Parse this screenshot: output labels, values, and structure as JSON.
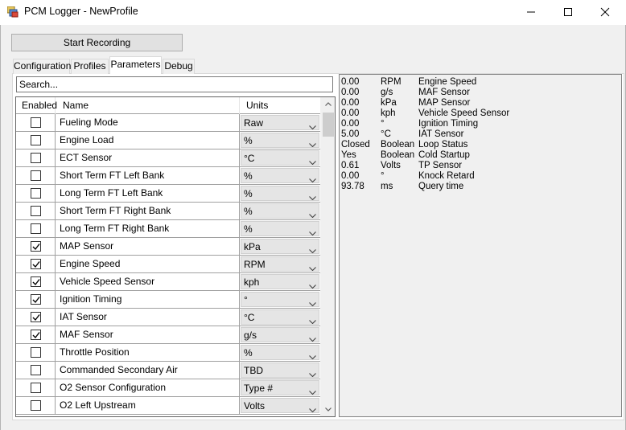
{
  "window": {
    "title": "PCM Logger - NewProfile"
  },
  "toolbar": {
    "start_label": "Start Recording"
  },
  "tabs": [
    {
      "label": "Configuration"
    },
    {
      "label": "Profiles"
    },
    {
      "label": "Parameters",
      "active": true
    },
    {
      "label": "Debug"
    }
  ],
  "search": {
    "placeholder": "Search..."
  },
  "grid": {
    "headers": {
      "enabled": "Enabled",
      "name": "Name",
      "units": "Units"
    },
    "rows": [
      {
        "enabled": false,
        "name": "Fueling Mode",
        "units": "Raw"
      },
      {
        "enabled": false,
        "name": "Engine Load",
        "units": "%"
      },
      {
        "enabled": false,
        "name": "ECT Sensor",
        "units": "°C"
      },
      {
        "enabled": false,
        "name": "Short Term FT Left Bank",
        "units": "%"
      },
      {
        "enabled": false,
        "name": "Long Term FT Left Bank",
        "units": "%"
      },
      {
        "enabled": false,
        "name": "Short Term FT Right Bank",
        "units": "%"
      },
      {
        "enabled": false,
        "name": "Long Term FT Right Bank",
        "units": "%"
      },
      {
        "enabled": true,
        "name": "MAP Sensor",
        "units": "kPa"
      },
      {
        "enabled": true,
        "name": "Engine Speed",
        "units": "RPM"
      },
      {
        "enabled": true,
        "name": "Vehicle Speed Sensor",
        "units": "kph"
      },
      {
        "enabled": true,
        "name": "Ignition Timing",
        "units": "°"
      },
      {
        "enabled": true,
        "name": "IAT Sensor",
        "units": "°C"
      },
      {
        "enabled": true,
        "name": "MAF Sensor",
        "units": "g/s"
      },
      {
        "enabled": false,
        "name": "Throttle Position",
        "units": "%"
      },
      {
        "enabled": false,
        "name": "Commanded Secondary Air",
        "units": "TBD"
      },
      {
        "enabled": false,
        "name": "O2 Sensor Configuration",
        "units": "Type #"
      },
      {
        "enabled": false,
        "name": "O2 Left Upstream",
        "units": "Volts"
      }
    ]
  },
  "output": {
    "lines": [
      {
        "value": "0.00",
        "unit": "RPM",
        "name": "Engine Speed"
      },
      {
        "value": "0.00",
        "unit": "g/s",
        "name": "MAF Sensor"
      },
      {
        "value": "0.00",
        "unit": "kPa",
        "name": "MAP Sensor"
      },
      {
        "value": "0.00",
        "unit": "kph",
        "name": "Vehicle Speed Sensor"
      },
      {
        "value": "0.00",
        "unit": "°",
        "name": "Ignition Timing"
      },
      {
        "value": "5.00",
        "unit": "°C",
        "name": "IAT Sensor"
      },
      {
        "value": "Closed",
        "unit": "Boolean",
        "name": "Loop Status"
      },
      {
        "value": "Yes",
        "unit": "Boolean",
        "name": "Cold Startup"
      },
      {
        "value": "0.61",
        "unit": "Volts",
        "name": "TP Sensor"
      },
      {
        "value": "0.00",
        "unit": "°",
        "name": "Knock Retard"
      },
      {
        "value": "93.78",
        "unit": "ms",
        "name": "Query time"
      }
    ]
  },
  "icons": {
    "app": "app-icon",
    "minimize": "minimize-icon",
    "maximize": "maximize-icon",
    "close": "close-icon",
    "checkmark": "checkmark-icon",
    "dropdown": "chevron-down-icon"
  }
}
